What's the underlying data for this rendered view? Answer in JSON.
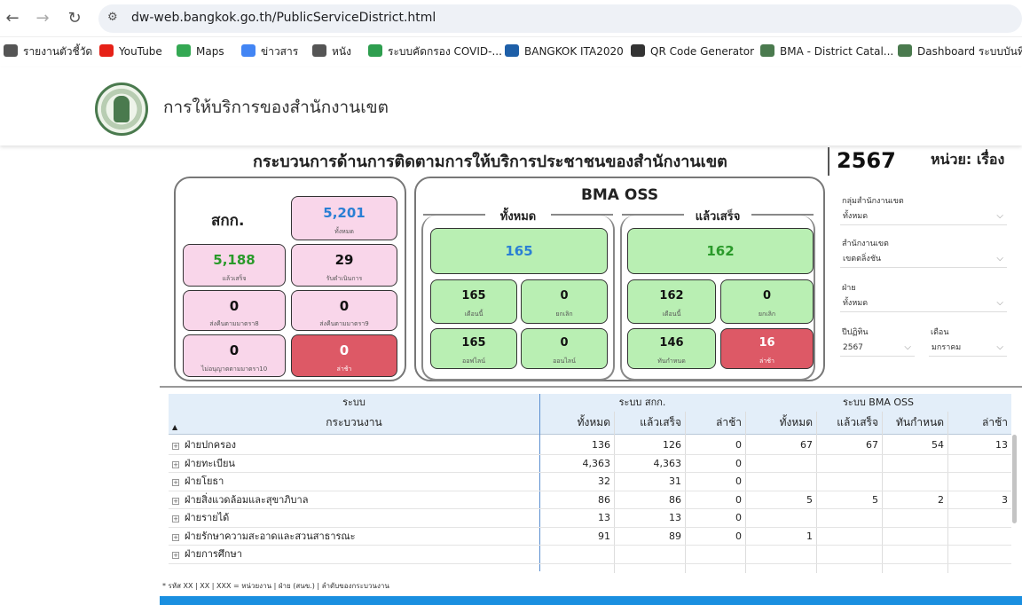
{
  "browser": {
    "url": "dw-web.bangkok.go.th/PublicServiceDistrict.html",
    "bookmarks": [
      {
        "label": "รายงานตัวชี้วัด",
        "color": "#555555"
      },
      {
        "label": "YouTube",
        "color": "#e62117"
      },
      {
        "label": "Maps",
        "color": "#34a853"
      },
      {
        "label": "ข่าวสาร",
        "color": "#4285f4"
      },
      {
        "label": "หนัง",
        "color": "#555555"
      },
      {
        "label": "ระบบคัดกรอง COVID-...",
        "color": "#2e9e4f"
      },
      {
        "label": "BANGKOK ITA2020",
        "color": "#1e5fa8"
      },
      {
        "label": "QR Code Generator",
        "color": "#333333"
      },
      {
        "label": "BMA - District Catal...",
        "color": "#4a7a4e"
      },
      {
        "label": "Dashboard ระบบบันทึ...",
        "color": "#4a7a4e"
      }
    ]
  },
  "header": {
    "title": "การให้บริการของสำนักงานเขต"
  },
  "dashboard": {
    "title": "กระบวนการด้านการติดตามการให้บริการประชาชนของสำนักงานเขต",
    "year": "2567",
    "unit": "หน่วย: เรื่อง",
    "sakk": {
      "label": "สกก.",
      "total": {
        "value": "5,201",
        "label": "ทั้งหมด"
      },
      "done": {
        "value": "5,188",
        "label": "แล้วเสร็จ"
      },
      "in_progress": {
        "value": "29",
        "label": "รับดำเนินการ"
      },
      "return8": {
        "value": "0",
        "label": "ส่งคืนตามมาตรา8"
      },
      "return9": {
        "value": "0",
        "label": "ส่งคืนตามมาตรา9"
      },
      "deny10": {
        "value": "0",
        "label": "ไม่อนุญาตตามมาตรา10"
      },
      "late": {
        "value": "0",
        "label": "ล่าช้า"
      }
    },
    "oss": {
      "title": "BMA OSS",
      "all": {
        "legend": "ทั้งหมด",
        "total": "165",
        "this_month": {
          "value": "165",
          "label": "เดือนนี้"
        },
        "cancel": {
          "value": "0",
          "label": "ยกเลิก"
        },
        "offline": {
          "value": "165",
          "label": "ออฟไลน์"
        },
        "online": {
          "value": "0",
          "label": "ออนไลน์"
        }
      },
      "done": {
        "legend": "แล้วเสร็จ",
        "total": "162",
        "this_month": {
          "value": "162",
          "label": "เดือนนี้"
        },
        "cancel": {
          "value": "0",
          "label": "ยกเลิก"
        },
        "on_time": {
          "value": "146",
          "label": "ทันกำหนด"
        },
        "late": {
          "value": "16",
          "label": "ล่าช้า"
        }
      }
    },
    "filters": {
      "group_label": "กลุ่มสำนักงานเขต",
      "group_value": "ทั้งหมด",
      "office_label": "สำนักงานเขต",
      "office_value": "เขตตลิ่งชัน",
      "division_label": "ฝ่าย",
      "division_value": "ทั้งหมด",
      "fy_label": "ปีปฏิทิน",
      "fy_value": "2567",
      "month_label": "เดือน",
      "month_value": "มกราคม"
    }
  },
  "table": {
    "group_system": "ระบบ",
    "group_sakk": "ระบบ สกก.",
    "group_oss": "ระบบ BMA OSS",
    "headers": [
      "กระบวนงาน",
      "ทั้งหมด",
      "แล้วเสร็จ",
      "ล่าช้า",
      "ทั้งหมด",
      "แล้วเสร็จ",
      "ทันกำหนด",
      "ล่าช้า"
    ],
    "sort_indicator": "▲",
    "rows": [
      [
        "ฝ่ายปกครอง",
        "136",
        "126",
        "0",
        "67",
        "67",
        "54",
        "13"
      ],
      [
        "ฝ่ายทะเบียน",
        "4,363",
        "4,363",
        "0",
        "",
        "",
        "",
        ""
      ],
      [
        "ฝ่ายโยธา",
        "32",
        "31",
        "0",
        "",
        "",
        "",
        ""
      ],
      [
        "ฝ่ายสิ่งแวดล้อมและสุขาภิบาล",
        "86",
        "86",
        "0",
        "5",
        "5",
        "2",
        "3"
      ],
      [
        "ฝ่ายรายได้",
        "13",
        "13",
        "0",
        "",
        "",
        "",
        ""
      ],
      [
        "ฝ่ายรักษาความสะอาดและสวนสาธารณะ",
        "91",
        "89",
        "0",
        "1",
        "",
        "",
        ""
      ],
      [
        "ฝ่ายการศึกษา",
        "",
        "",
        "",
        "",
        "",
        "",
        ""
      ]
    ],
    "footnote": "* รหัส XX | XX | XXX = หน่วยงาน | ฝ่าย (สนข.) | ลำดับของกระบวนงาน"
  }
}
